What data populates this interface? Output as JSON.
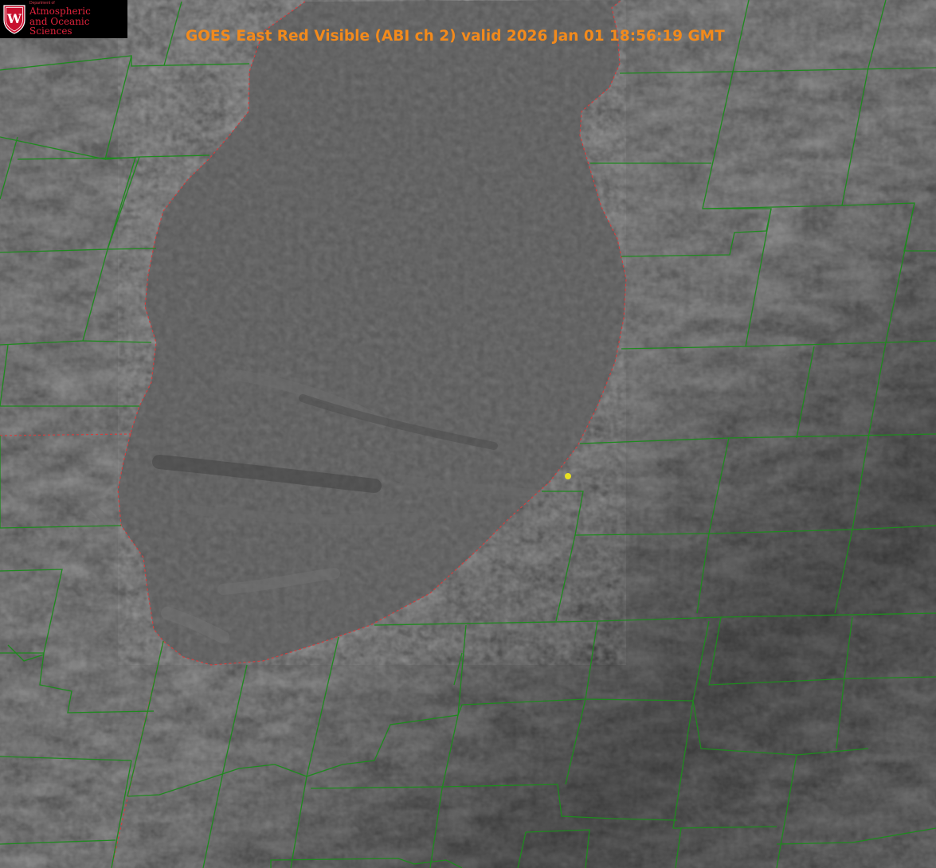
{
  "title": "GOES East Red Visible (ABI ch 2) valid 2026 Jan 01 18:56:19 GMT",
  "logo": {
    "dept": "Department of",
    "line1": "Atmospheric",
    "line2": "and Oceanic Sciences",
    "crest_letter": "W",
    "icon": "uw-crest-icon"
  },
  "colors": {
    "title": "#f28a1c",
    "county_lines": "#1f8a1f",
    "state_line": "#d04040",
    "marker": "#e8e020",
    "lake": "#5e5e5e",
    "land": "#555555"
  },
  "marker": {
    "label": "",
    "icon": "location-dot-icon"
  }
}
